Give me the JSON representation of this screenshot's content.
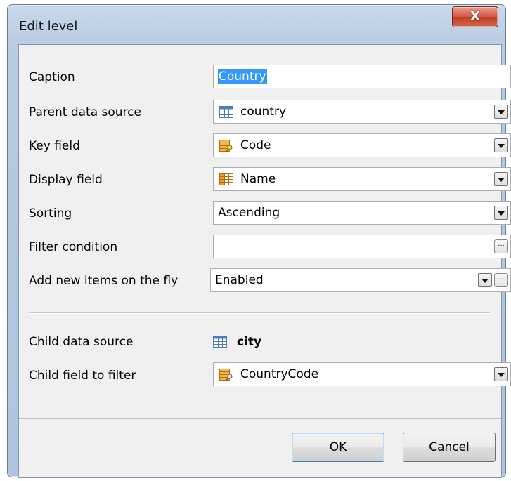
{
  "window": {
    "title": "Edit level",
    "close_glyph": "X"
  },
  "fields": {
    "caption": {
      "label": "Caption",
      "value": "Country"
    },
    "parent_data_source": {
      "label": "Parent data source",
      "value": "country",
      "icon": "table-icon"
    },
    "key_field": {
      "label": "Key field",
      "value": "Code",
      "icon": "key-field-icon"
    },
    "display_field": {
      "label": "Display field",
      "value": "Name",
      "icon": "field-icon"
    },
    "sorting": {
      "label": "Sorting",
      "value": "Ascending"
    },
    "filter_condition": {
      "label": "Filter condition",
      "value": "",
      "ellipsis": "..."
    },
    "add_new_items": {
      "label": "Add new items on the fly",
      "value": "Enabled",
      "ellipsis": "..."
    },
    "child_data_source": {
      "label": "Child data source",
      "value": "city",
      "icon": "table-icon"
    },
    "child_field_to_filter": {
      "label": "Child field to filter",
      "value": "CountryCode",
      "icon": "key-field-icon"
    }
  },
  "buttons": {
    "ok": "OK",
    "cancel": "Cancel"
  }
}
